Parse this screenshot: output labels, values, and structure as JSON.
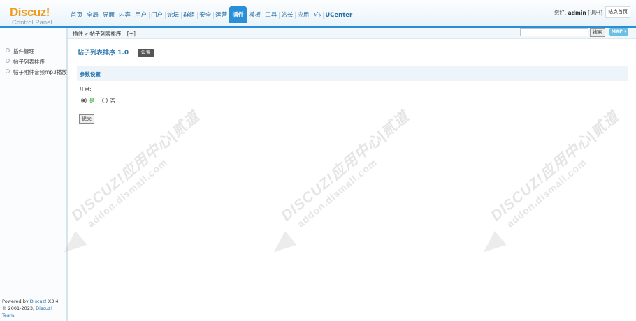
{
  "logo": {
    "brand": "Discuz!",
    "subtitle": "Control Panel"
  },
  "topnav": [
    {
      "label": "首页"
    },
    {
      "label": "全局"
    },
    {
      "label": "界面"
    },
    {
      "label": "内容"
    },
    {
      "label": "用户"
    },
    {
      "label": "门户"
    },
    {
      "label": "论坛"
    },
    {
      "label": "群组"
    },
    {
      "label": "安全"
    },
    {
      "label": "运营"
    },
    {
      "label": "插件",
      "active": true
    },
    {
      "label": "模板"
    },
    {
      "label": "工具"
    },
    {
      "label": "站长"
    },
    {
      "label": "应用中心"
    },
    {
      "label": "UCenter"
    }
  ],
  "user": {
    "greeting": "您好,",
    "name": "admin",
    "logout": "[退出]",
    "home_button": "站点首页"
  },
  "breadcrumb": {
    "text": "插件 » 帖子列表排序",
    "toggle": "[+]"
  },
  "search": {
    "value": "",
    "button": "搜索",
    "map": "MAP"
  },
  "sidebar": {
    "items": [
      {
        "label": "插件管理"
      },
      {
        "label": "帖子列表排序"
      },
      {
        "label": "帖子附件音频mp3播放"
      }
    ],
    "footer": {
      "powered_prefix": "Powered by",
      "powered_link": "Discuz!",
      "version": "X3.4",
      "copyright_prefix": "© 2001-2023,",
      "copyright_link": "Discuz! Team."
    }
  },
  "main": {
    "plugin_title": "帖子列表排序 1.0",
    "settings_button": "设置",
    "section_title": "参数设置",
    "field_label": "开启:",
    "option_yes": "是",
    "option_no": "否",
    "selected_option": "是",
    "submit": "提交"
  },
  "watermark": {
    "line1": "DISCUZ!应用中心|贰道",
    "line2": "addon.dismall.com"
  },
  "colors": {
    "accent": "#2b8fd8",
    "logo": "#f09b1c",
    "link": "#2a78b0",
    "yes": "#1aa31a"
  }
}
